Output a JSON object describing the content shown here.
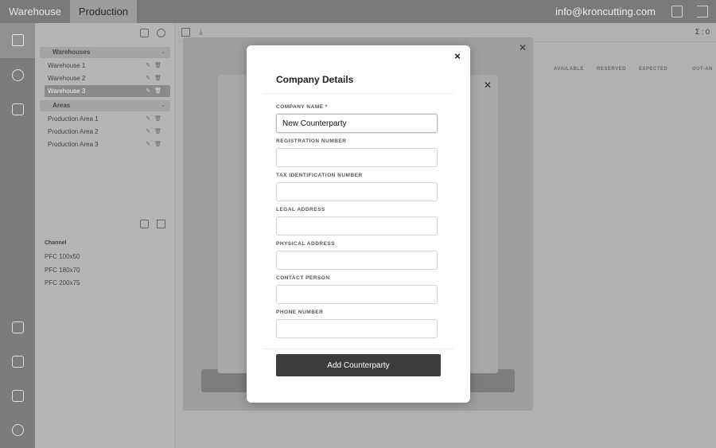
{
  "topbar": {
    "tabs": [
      "Warehouse",
      "Production"
    ],
    "email": "info@kroncutting.com"
  },
  "left_panel": {
    "warehouses_label": "Warehouses",
    "warehouses": [
      "Warehouse 1",
      "Warehouse 2",
      "Warehouse 3"
    ],
    "areas_label": "Areas",
    "areas": [
      "Production Area 1",
      "Production Area 2",
      "Production Area 3"
    ],
    "materials_header": "Channel",
    "materials": [
      {
        "name": "PFC 100x50"
      },
      {
        "name": "PFC 180x70"
      },
      {
        "name": "PFC 200x75"
      }
    ]
  },
  "main": {
    "quantity": "Σ : 0",
    "column_headers": [
      "AVAILABLE",
      "RESERVED",
      "EXPECTED",
      "OUT-AN"
    ]
  },
  "modal": {
    "title": "Company Details",
    "close_symbol": "×",
    "fields": [
      {
        "label": "COMPANY NAME",
        "required": "*",
        "value": "New Counterparty"
      },
      {
        "label": "REGISTRATION NUMBER",
        "value": ""
      },
      {
        "label": "TAX IDENTIFICATION NUMBER",
        "value": ""
      },
      {
        "label": "LEGAL ADDRESS",
        "value": ""
      },
      {
        "label": "PHYSICAL ADDRESS",
        "value": ""
      },
      {
        "label": "CONTACT PERSON",
        "value": ""
      },
      {
        "label": "PHONE NUMBER",
        "value": ""
      }
    ],
    "submit_label": "Add Counterparty"
  }
}
